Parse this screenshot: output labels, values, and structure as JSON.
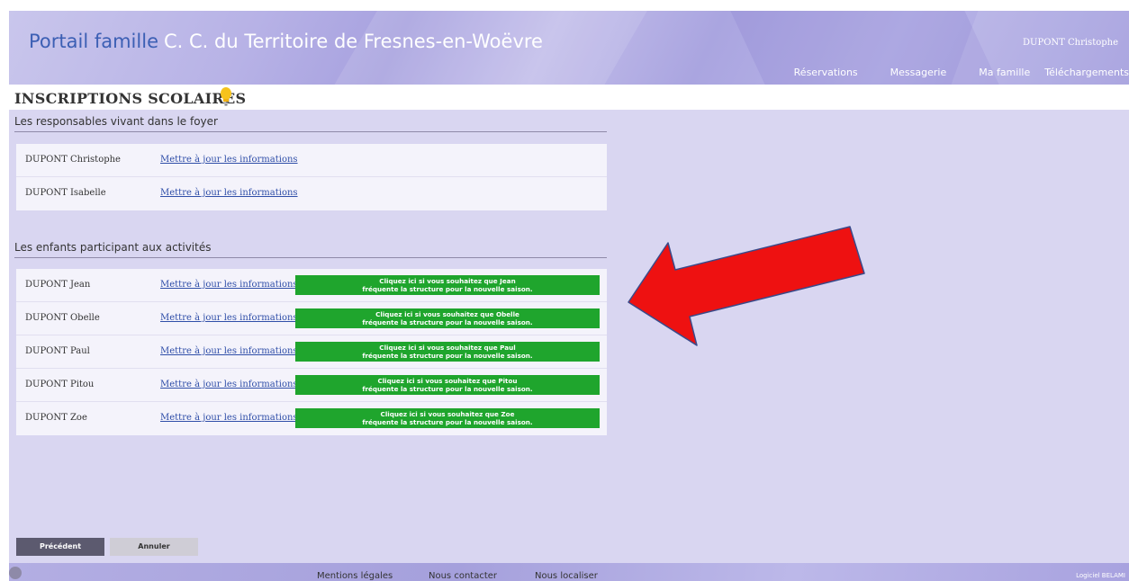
{
  "header": {
    "brand_part1": "Portail famille",
    "brand_part2": "C. C. du Territoire de Fresnes-en-Woëvre",
    "user_name": "DUPONT Christophe",
    "nav": [
      "Réservations",
      "Messagerie",
      "Ma famille",
      "Téléchargements"
    ]
  },
  "page": {
    "title": "INSCRIPTIONS SCOLAIRES"
  },
  "responsables": {
    "title": "Les responsables vivant dans le foyer",
    "rows": [
      {
        "name": "DUPONT Christophe",
        "link": "Mettre à jour les informations"
      },
      {
        "name": "DUPONT Isabelle",
        "link": "Mettre à jour les informations"
      }
    ]
  },
  "enfants": {
    "title": "Les enfants participant aux activités",
    "rows": [
      {
        "name": "DUPONT Jean",
        "link": "Mettre à jour les informations",
        "enroll_line1": "Cliquez ici si vous souhaitez que Jean",
        "enroll_line2": "fréquente la structure pour la nouvelle saison."
      },
      {
        "name": "DUPONT Obelle",
        "link": "Mettre à jour les informations",
        "enroll_line1": "Cliquez ici si vous souhaitez que Obelle",
        "enroll_line2": "fréquente la structure pour la nouvelle saison."
      },
      {
        "name": "DUPONT Paul",
        "link": "Mettre à jour les informations",
        "enroll_line1": "Cliquez ici si vous souhaitez que Paul",
        "enroll_line2": "fréquente la structure pour la nouvelle saison."
      },
      {
        "name": "DUPONT Pitou",
        "link": "Mettre à jour les informations",
        "enroll_line1": "Cliquez ici si vous souhaitez que Pitou",
        "enroll_line2": "fréquente la structure pour la nouvelle saison."
      },
      {
        "name": "DUPONT Zoe",
        "link": "Mettre à jour les informations",
        "enroll_line1": "Cliquez ici si vous souhaitez que Zoe",
        "enroll_line2": "fréquente la structure pour la nouvelle saison."
      }
    ]
  },
  "buttons": {
    "previous": "Précédent",
    "cancel": "Annuler"
  },
  "footer": {
    "links": [
      "Mentions légales",
      "Nous contacter",
      "Nous localiser"
    ],
    "credit": "Logiciel BELAMI"
  },
  "colors": {
    "brand_blue": "#3c5fb4",
    "enroll_green": "#1fa52d",
    "annotation_arrow": "#ee1111"
  },
  "icons": {
    "title_icon": "lightbulb-icon",
    "annotation": "red-arrow-icon"
  }
}
